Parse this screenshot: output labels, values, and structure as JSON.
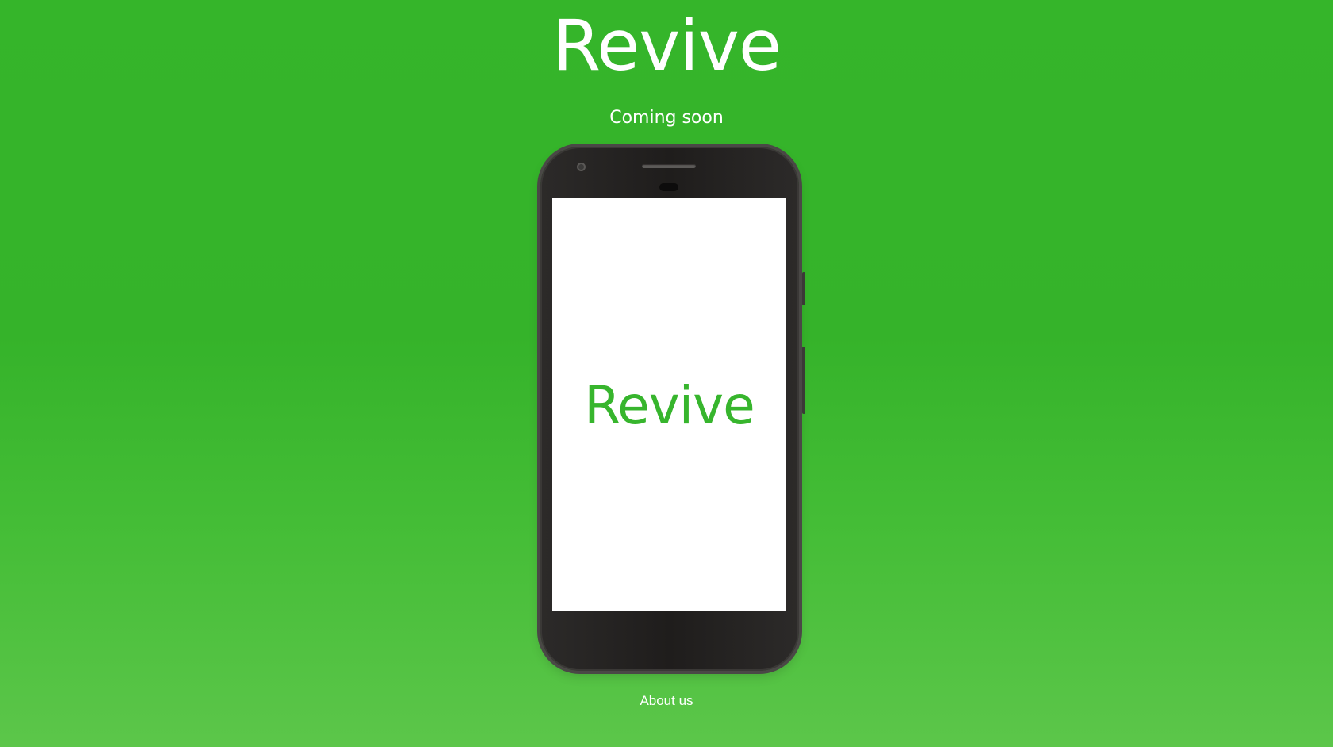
{
  "header": {
    "title": "Revive",
    "subtitle": "Coming soon"
  },
  "phone": {
    "screen_logo": "Revive"
  },
  "footer": {
    "about_label": "About us"
  },
  "colors": {
    "background": "#35b52a",
    "brand_green": "#37b52d",
    "phone_body": "#221f1e",
    "text": "#ffffff"
  }
}
